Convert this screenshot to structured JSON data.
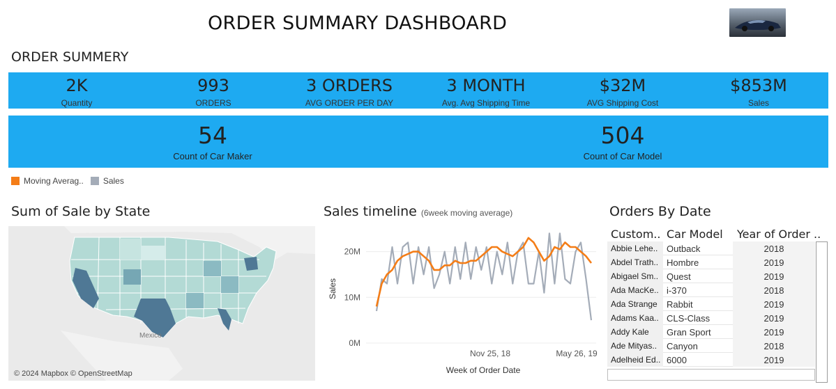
{
  "header": {
    "title": "ORDER SUMMARY DASHBOARD",
    "section_title": "ORDER SUMMERY"
  },
  "kpis_row1": [
    {
      "value": "2K",
      "label": "Quantity"
    },
    {
      "value": "993",
      "label": "ORDERS"
    },
    {
      "value": "3 ORDERS",
      "label": "AVG ORDER PER DAY"
    },
    {
      "value": "3 MONTH",
      "label": "Avg. Avg Shipping Time"
    },
    {
      "value": "$32M",
      "label": "AVG Shipping Cost"
    },
    {
      "value": "$853M",
      "label": "Sales"
    }
  ],
  "kpis_row2": [
    {
      "value": "54",
      "label": "Count of Car Maker"
    },
    {
      "value": "504",
      "label": "Count of Car Model"
    }
  ],
  "legend": [
    {
      "label": "Moving Averag..",
      "color": "#f47d17"
    },
    {
      "label": "Sales",
      "color": "#a4acb8"
    }
  ],
  "map_panel": {
    "title": "Sum of Sale by State",
    "credit": "© 2024 Mapbox © OpenStreetMap",
    "label_mexico": "Mexico"
  },
  "timeline_panel": {
    "title": "Sales timeline",
    "subtitle": "(6week moving average)",
    "ylabel": "Sales",
    "xlabel": "Week of Order Date"
  },
  "chart_data": {
    "type": "line",
    "xlabel": "Week of Order Date",
    "ylabel": "Sales",
    "ylim": [
      0,
      24
    ],
    "y_ticks": [
      "0M",
      "10M",
      "20M"
    ],
    "x_ticks": [
      "Nov 25, 18",
      "May 26, 19"
    ],
    "series": [
      {
        "name": "Sales",
        "values": [
          7,
          14,
          13,
          21,
          13,
          21,
          22,
          13,
          21,
          15,
          21,
          12,
          15,
          20,
          13,
          21,
          14,
          22,
          14,
          21,
          16,
          21,
          13,
          20,
          15,
          22,
          13,
          20,
          22,
          13,
          13,
          20,
          11,
          24,
          13,
          24,
          14,
          13,
          20,
          22,
          14,
          5
        ]
      },
      {
        "name": "Moving Averag..",
        "values": [
          8,
          13,
          15,
          16,
          18,
          19,
          19.5,
          20,
          20,
          19,
          18,
          16,
          16,
          17,
          17,
          18,
          17.5,
          17.5,
          18,
          18,
          19,
          20,
          21,
          21,
          20,
          19.5,
          19,
          20,
          21,
          23,
          22,
          20,
          18,
          19,
          21,
          20.5,
          22,
          21,
          21,
          20,
          19,
          17.5
        ]
      }
    ]
  },
  "orders_table": {
    "title": "Orders By Date",
    "columns": [
      "Custom..",
      "Car Model",
      "Year of Order .."
    ],
    "rows": [
      [
        "Abbie Lehe..",
        "Outback",
        "2018"
      ],
      [
        "Abdel Trath..",
        "Hombre",
        "2019"
      ],
      [
        "Abigael Sm..",
        "Quest",
        "2019"
      ],
      [
        "Ada MacKe..",
        "i-370",
        "2018"
      ],
      [
        "Ada Strange",
        "Rabbit",
        "2019"
      ],
      [
        "Adams Kaa..",
        "CLS-Class",
        "2019"
      ],
      [
        "Addy Kale",
        "Gran Sport",
        "2019"
      ],
      [
        "Ade Mityas..",
        "Canyon",
        "2018"
      ],
      [
        "Adelheid Ed..",
        "6000",
        "2019"
      ]
    ]
  },
  "colors": {
    "kpi_band": "#1eaaf1",
    "map_dark": "#4f7895",
    "map_light": "#b3dad5"
  }
}
